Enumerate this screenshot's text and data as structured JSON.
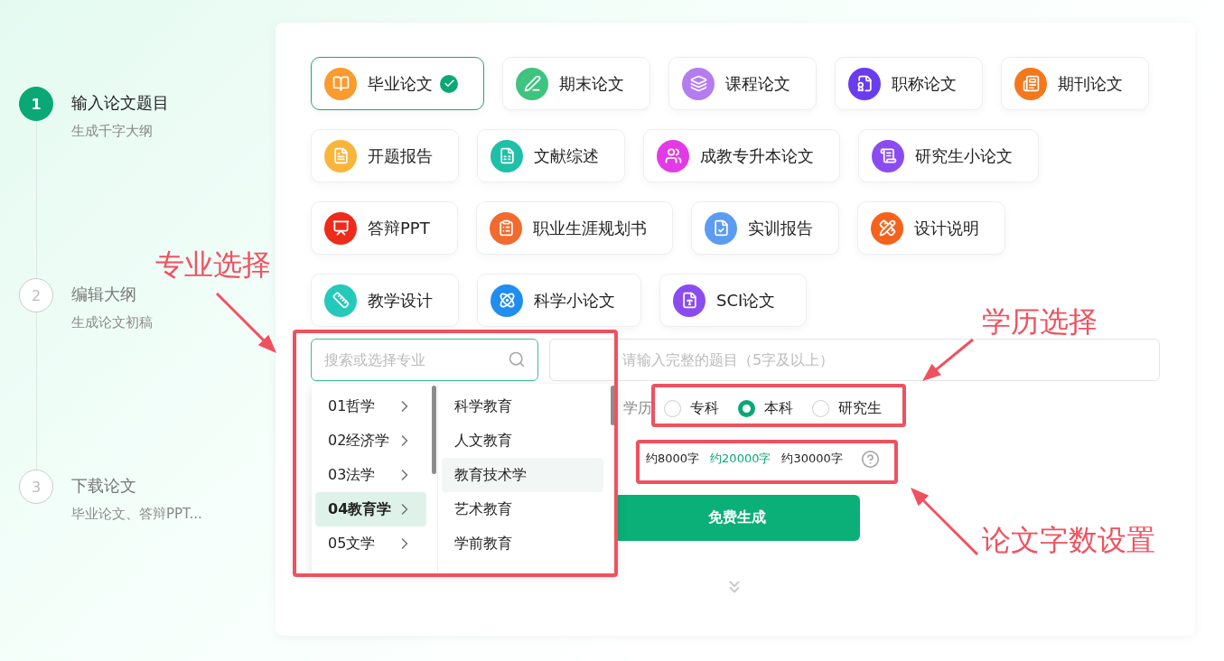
{
  "steps": [
    {
      "number": "1",
      "title": "输入论文题目",
      "subtitle": "生成千字大纲",
      "active": true
    },
    {
      "number": "2",
      "title": "编辑大纲",
      "subtitle": "生成论文初稿",
      "active": false
    },
    {
      "number": "3",
      "title": "下载论文",
      "subtitle": "毕业论文、答辩PPT...",
      "active": false
    }
  ],
  "paper_types": [
    {
      "label": "毕业论文",
      "selected": true,
      "color": "#fb9a2f"
    },
    {
      "label": "期末论文",
      "selected": false,
      "color": "#3ec47e"
    },
    {
      "label": "课程论文",
      "selected": false,
      "color": "#b57cf0"
    },
    {
      "label": "职称论文",
      "selected": false,
      "color": "#6a3cf0"
    },
    {
      "label": "期刊论文",
      "selected": false,
      "color": "#f5771c"
    },
    {
      "label": "开题报告",
      "selected": false,
      "color": "#f9b53a"
    },
    {
      "label": "文献综述",
      "selected": false,
      "color": "#1fbfa8"
    },
    {
      "label": "成教专升本论文",
      "selected": false,
      "color": "#e43ae6"
    },
    {
      "label": "研究生小论文",
      "selected": false,
      "color": "#8a4cf0"
    },
    {
      "label": "答辩PPT",
      "selected": false,
      "color": "#ee2b1a"
    },
    {
      "label": "职业生涯规划书",
      "selected": false,
      "color": "#f36a2e"
    },
    {
      "label": "实训报告",
      "selected": false,
      "color": "#5b9cf2"
    },
    {
      "label": "设计说明",
      "selected": false,
      "color": "#f5621c"
    },
    {
      "label": "教学设计",
      "selected": false,
      "color": "#25c9b9"
    },
    {
      "label": "科学小论文",
      "selected": false,
      "color": "#1f8ef0"
    },
    {
      "label": "SCI论文",
      "selected": false,
      "color": "#8a4cf0"
    }
  ],
  "major_search": {
    "placeholder": "搜索或选择专业",
    "focused": true
  },
  "major_dropdown": {
    "categories": [
      {
        "label": "01哲学",
        "selected": false
      },
      {
        "label": "02经济学",
        "selected": false
      },
      {
        "label": "03法学",
        "selected": false
      },
      {
        "label": "04教育学",
        "selected": true
      },
      {
        "label": "05文学",
        "selected": false
      }
    ],
    "subjects": [
      {
        "label": "科学教育",
        "highlighted": false
      },
      {
        "label": "人文教育",
        "highlighted": false
      },
      {
        "label": "教育技术学",
        "highlighted": true
      },
      {
        "label": "艺术教育",
        "highlighted": false
      },
      {
        "label": "学前教育",
        "highlighted": false
      }
    ]
  },
  "topic_field": {
    "placeholder": "请输入完整的题目（5字及以上）"
  },
  "education": {
    "label": "学历",
    "options": [
      {
        "label": "专科",
        "selected": false
      },
      {
        "label": "本科",
        "selected": true
      },
      {
        "label": "研究生",
        "selected": false
      }
    ]
  },
  "word_count": {
    "options": [
      {
        "label": "约8000字",
        "selected": false
      },
      {
        "label": "约20000字",
        "selected": true
      },
      {
        "label": "约30000字",
        "selected": false
      }
    ]
  },
  "generate_button": "免费生成",
  "annotations": [
    {
      "label": "专业选择"
    },
    {
      "label": "学历选择"
    },
    {
      "label": "论文字数设置"
    }
  ]
}
